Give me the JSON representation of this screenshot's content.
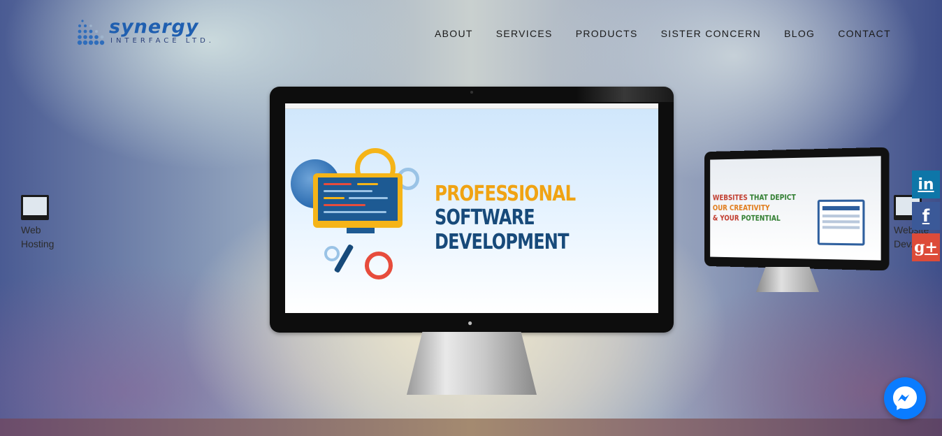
{
  "brand": {
    "logo_top": "synergy",
    "logo_bottom": "INTERFACE LTD."
  },
  "nav": {
    "items": [
      {
        "label": "ABOUT"
      },
      {
        "label": "SERVICES"
      },
      {
        "label": "PRODUCTS"
      },
      {
        "label": "SISTER CONCERN"
      },
      {
        "label": "BLOG"
      },
      {
        "label": "CONTACT"
      }
    ]
  },
  "slider": {
    "main_slide": {
      "line1": "PROFESSIONAL",
      "line2": "SOFTWARE DEVELOPMENT"
    },
    "right_slide": {
      "line1_a": "WEBSITES ",
      "line1_b": "THAT DEPICT",
      "line2": "OUR CREATIVITY",
      "line3_a": "& YOUR ",
      "line3_b": "POTENTIAL"
    },
    "prev_thumb": {
      "line1": "Web",
      "line2": "Hosting"
    },
    "next_thumb": {
      "line1": "Website",
      "line2": "Dev..."
    }
  },
  "social": {
    "linkedin": "in",
    "facebook": "f",
    "googleplus": "g+"
  },
  "colors": {
    "linkedin": "#0e76a8",
    "facebook": "#3b5998",
    "googleplus": "#dd4b39",
    "messenger": "#0a7cff",
    "headline_orange": "#f0a313",
    "headline_blue": "#174a7a"
  },
  "icons": [
    "messenger-icon",
    "apple-icon",
    "linkedin-icon",
    "facebook-icon",
    "googleplus-icon"
  ]
}
